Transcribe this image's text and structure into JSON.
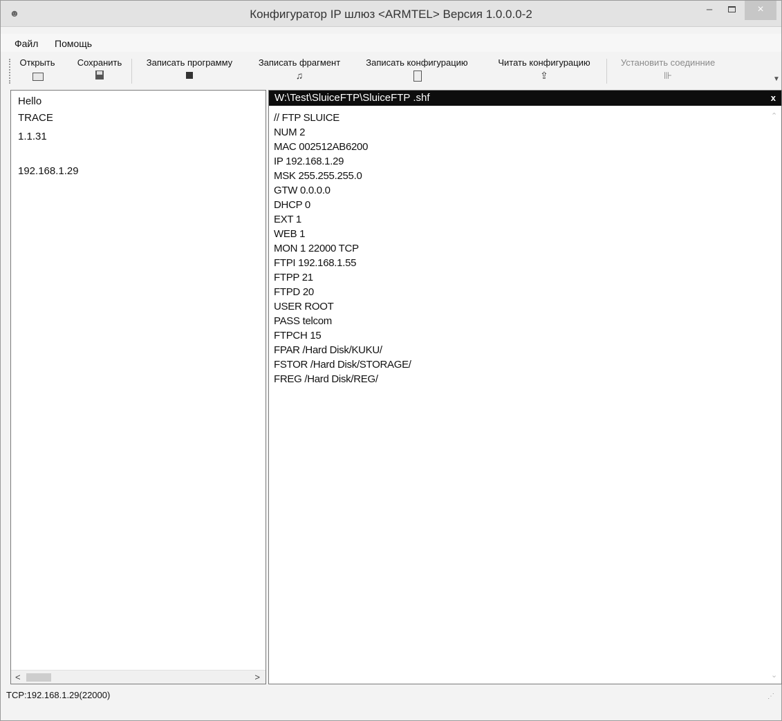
{
  "window": {
    "title": "Конфигуратор IP шлюз <ARMTEL> Версия 1.0.0.0-2",
    "minimize_glyph": "–",
    "close_glyph": "×"
  },
  "menu": {
    "items": [
      {
        "label": "Файл"
      },
      {
        "label": "Помощь"
      }
    ]
  },
  "toolbar": {
    "open_label": "Открыть",
    "save_label": "Сохранить",
    "write_program_label": "Записать программу",
    "write_fragment_label": "Записать фрагмент",
    "write_config_label": "Записать конфигурацию",
    "read_config_label": "Читать конфигурацию",
    "connect_label": "Установить соединние",
    "icons": {
      "open": "folder-open-icon",
      "save": "floppy-disk-icon",
      "write_program": "chip-icon",
      "write_fragment": "fragment-icon",
      "write_config": "document-write-icon",
      "read_config": "read-config-icon",
      "connect": "plug-icon"
    }
  },
  "left_panel": {
    "lines": [
      "Hello",
      "TRACE",
      "1.1.31",
      "",
      "192.168.1.29"
    ]
  },
  "editor": {
    "tab_title": "W:\\Test\\SluiceFTP\\SluiceFTP .shf",
    "tab_close": "x",
    "lines": [
      "// FTP SLUICE",
      "NUM 2",
      "MAC 002512AB6200",
      "IP 192.168.1.29",
      "MSK 255.255.255.0",
      "GTW 0.0.0.0",
      "DHCP 0",
      "EXT 1",
      "WEB 1",
      "MON 1 22000 TCP",
      "FTPI 192.168.1.55",
      "FTPP 21",
      "FTPD 20",
      "USER ROOT",
      "PASS telcom",
      "FTPCH 15",
      "FPAR /Hard Disk/KUKU/",
      "FSTOR /Hard Disk/STORAGE/",
      "FREG /Hard Disk/REG/"
    ]
  },
  "status": {
    "text": "TCP:192.168.1.29(22000)"
  }
}
